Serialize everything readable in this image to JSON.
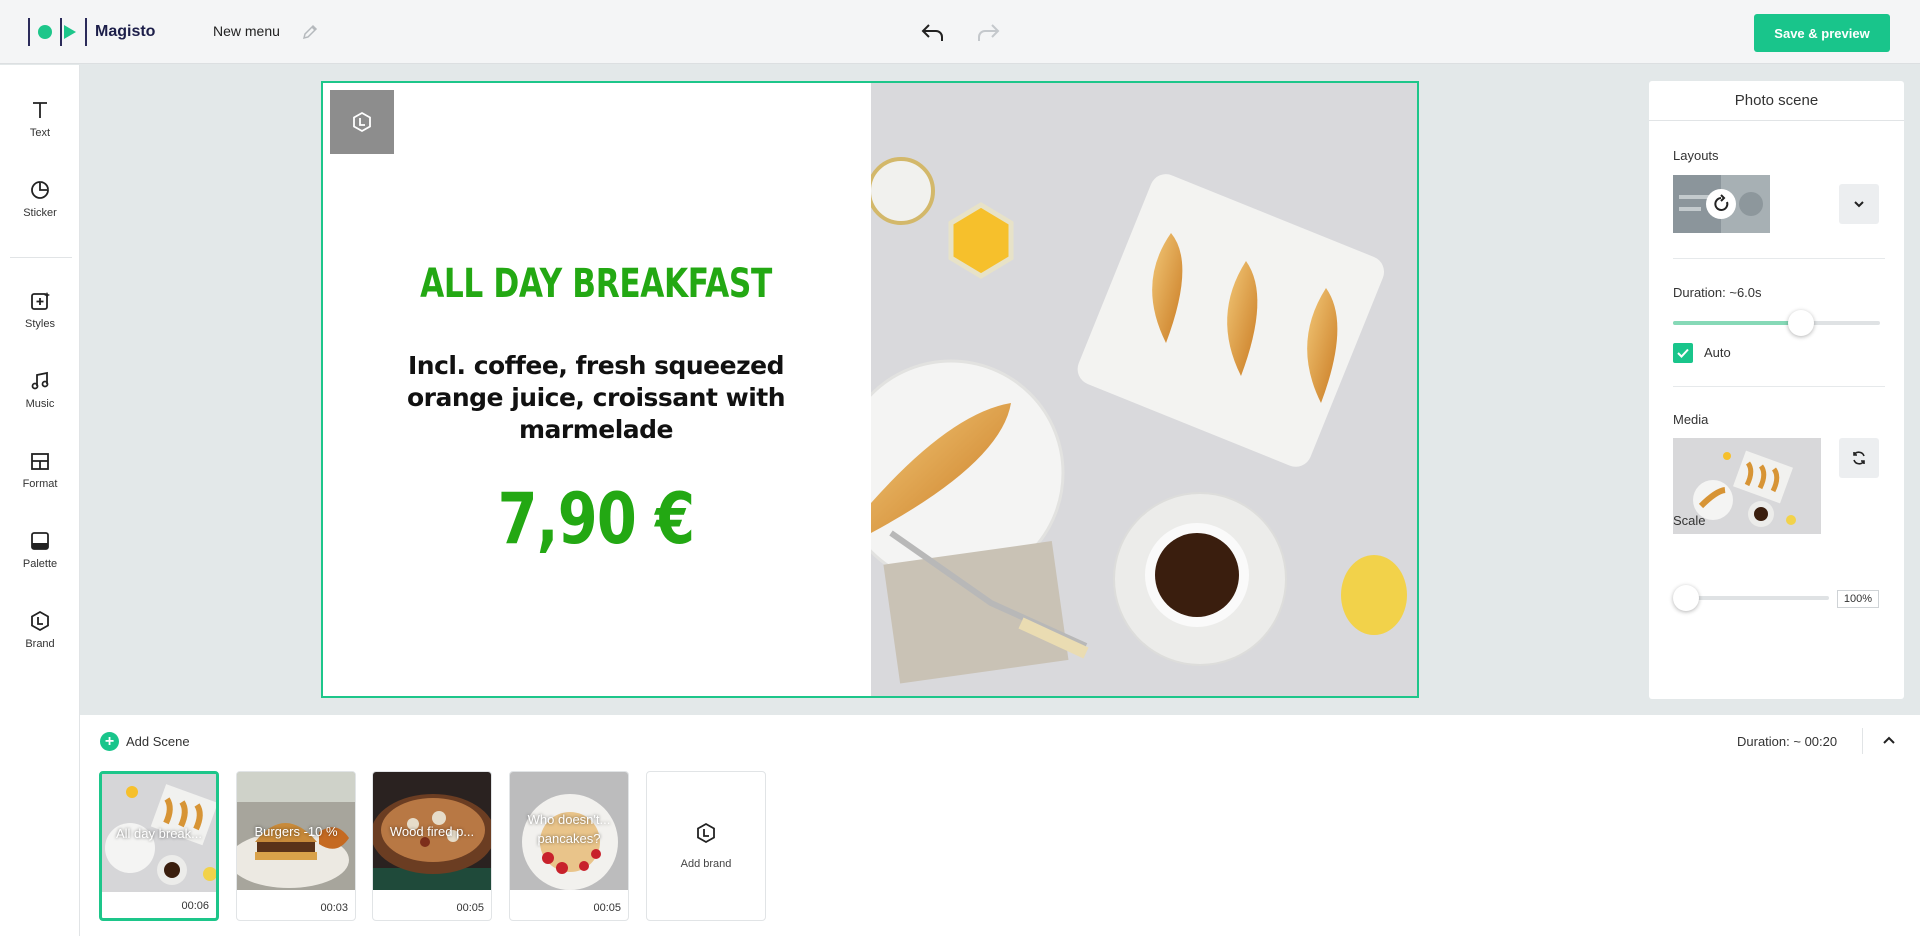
{
  "app": {
    "name": "Magisto",
    "project_name": "New menu",
    "save_label": "Save & preview"
  },
  "tools": [
    {
      "label": "Text",
      "icon": "text-icon"
    },
    {
      "label": "Sticker",
      "icon": "sticker-icon"
    },
    {
      "label": "Styles",
      "icon": "styles-icon"
    },
    {
      "label": "Music",
      "icon": "music-icon"
    },
    {
      "label": "Format",
      "icon": "format-icon"
    },
    {
      "label": "Palette",
      "icon": "palette-icon"
    },
    {
      "label": "Brand",
      "icon": "brand-icon"
    }
  ],
  "canvas": {
    "headline": "ALL DAY BREAKFAST",
    "subtext": "Incl. coffee, fresh squeezed orange juice, croissant with marmelade",
    "price": "7,90 €",
    "accent_color": "#23a813"
  },
  "panel": {
    "title": "Photo scene",
    "layouts_label": "Layouts",
    "duration_label": "Duration: ~6.0s",
    "duration_fraction": 0.62,
    "auto_label": "Auto",
    "auto_checked": true,
    "media_label": "Media",
    "scale_label": "Scale",
    "scale_value": "100%",
    "scale_fraction": 0.0
  },
  "timeline": {
    "add_scene_label": "Add Scene",
    "duration_label": "Duration: ~ 00:20",
    "add_brand_label": "Add brand",
    "scenes": [
      {
        "title": "All day break...",
        "duration": "00:06",
        "active": true
      },
      {
        "title": "Burgers -10 %",
        "duration": "00:03",
        "active": false
      },
      {
        "title": "Wood fired p...",
        "duration": "00:05",
        "active": false
      },
      {
        "title": "Who doesn't... pancakes?",
        "duration": "00:05",
        "active": false
      }
    ]
  },
  "colors": {
    "brand_green": "#19c58b",
    "frame_green": "#1dc68a"
  }
}
